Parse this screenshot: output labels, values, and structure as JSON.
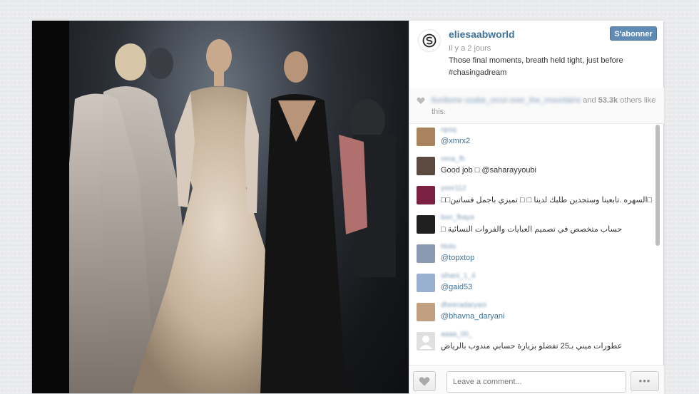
{
  "post": {
    "username": "eliesaabworld",
    "time_ago": "Il y a 2 jours",
    "caption": "Those final moments, breath held tight, just before #chasingadream",
    "follow_label": "S'abonner"
  },
  "likes": {
    "names": "liunilome ozabe_orcoi over_the_mountains",
    "connector": "and",
    "count": "53.3k",
    "suffix": "others like this."
  },
  "comments": [
    {
      "user": "npsq",
      "text": "@xmrx2",
      "avatar_color": "#a9835d"
    },
    {
      "user": "rena_fh",
      "text": "Good job □ @saharayyoubi",
      "avatar_color": "#5a4a40"
    },
    {
      "user": "yoor112",
      "text": "□□السهره .تابعينا وستجدين طلبك لدينا □ □ تميزي باجمل فساتين□",
      "avatar_color": "#7a2040"
    },
    {
      "user": "bon_fbaya",
      "text": "□ حساب متخصص في تصميم العبايات والفروات النسائية",
      "avatar_color": "#202020"
    },
    {
      "user": "hlolo",
      "text": "@topxtop",
      "avatar_color": "#8a9ab0"
    },
    {
      "user": "sihani_1_4",
      "text": "@gaid53",
      "avatar_color": "#9ab0d0"
    },
    {
      "user": "dheeradaryani",
      "text": "@bhavna_daryani",
      "avatar_color": "#c0a080"
    },
    {
      "user": "aaaa_00_",
      "text": "عطورات ميني بـ25 تفضلو بزيارة حسابي مندوب بالرياض",
      "avatar_color": "#e0e0e0"
    }
  ],
  "footer": {
    "comment_placeholder": "Leave a comment...",
    "more_label": "•••"
  },
  "colors": {
    "link": "#3f729b",
    "follow_button": "#5f8bb5"
  }
}
